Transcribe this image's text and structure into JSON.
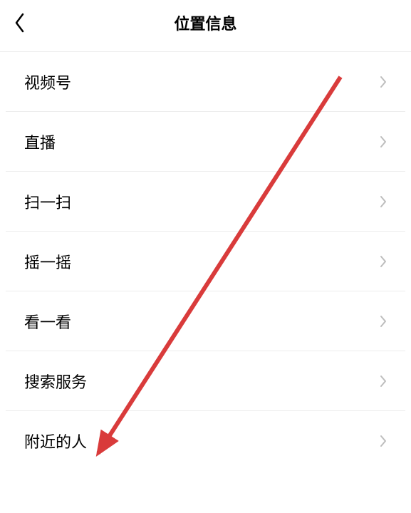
{
  "header": {
    "title": "位置信息"
  },
  "list": {
    "items": [
      {
        "label": "视频号"
      },
      {
        "label": "直播"
      },
      {
        "label": "扫一扫"
      },
      {
        "label": "摇一摇"
      },
      {
        "label": "看一看"
      },
      {
        "label": "搜索服务"
      },
      {
        "label": "附近的人"
      }
    ]
  },
  "annotation": {
    "color": "#d93b3b"
  }
}
